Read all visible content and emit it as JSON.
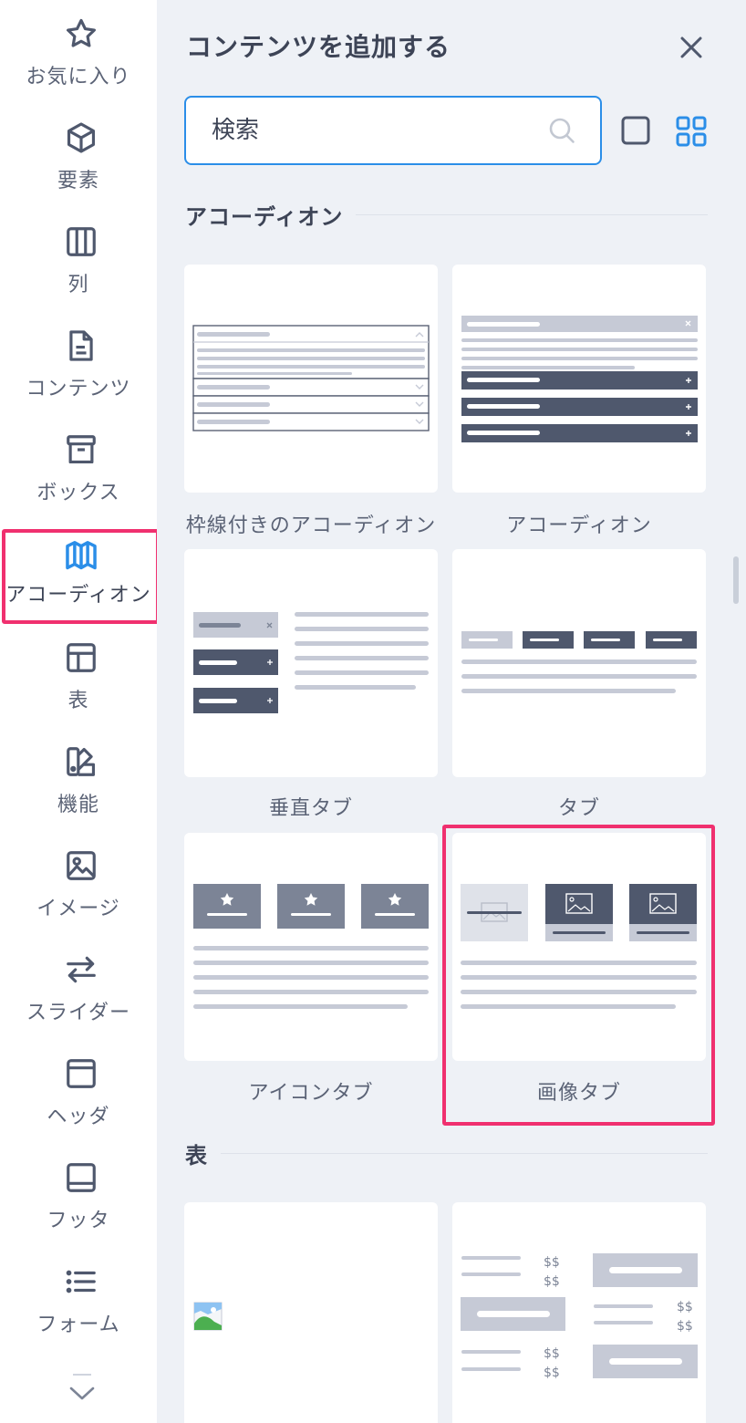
{
  "sidebar": {
    "items": [
      {
        "id": "favorites",
        "label": "お気に入り",
        "icon": "star-icon"
      },
      {
        "id": "elements",
        "label": "要素",
        "icon": "cube-icon"
      },
      {
        "id": "columns",
        "label": "列",
        "icon": "columns-icon"
      },
      {
        "id": "content",
        "label": "コンテンツ",
        "icon": "document-icon"
      },
      {
        "id": "box",
        "label": "ボックス",
        "icon": "archive-box-icon"
      },
      {
        "id": "accordion",
        "label": "アコーディオン",
        "icon": "map-icon",
        "active": true
      },
      {
        "id": "table",
        "label": "表",
        "icon": "table-icon"
      },
      {
        "id": "features",
        "label": "機能",
        "icon": "swatch-icon"
      },
      {
        "id": "image",
        "label": "イメージ",
        "icon": "image-icon"
      },
      {
        "id": "slider",
        "label": "スライダー",
        "icon": "arrows-swap-icon"
      },
      {
        "id": "header",
        "label": "ヘッダ",
        "icon": "header-layout-icon"
      },
      {
        "id": "footer",
        "label": "フッタ",
        "icon": "footer-layout-icon"
      },
      {
        "id": "form",
        "label": "フォーム",
        "icon": "list-icon"
      }
    ],
    "more_icon": "chevron-down-icon"
  },
  "panel": {
    "title": "コンテンツを追加する",
    "close_icon": "close-icon",
    "search": {
      "value": "",
      "placeholder": "検索",
      "icon": "search-icon"
    },
    "view_toggle": {
      "single_icon": "square-view-icon",
      "grid_icon": "grid-view-icon",
      "active": "grid"
    }
  },
  "sections": [
    {
      "title": "アコーディオン",
      "cards": [
        {
          "label": "枠線付きのアコーディオン"
        },
        {
          "label": "アコーディオン"
        },
        {
          "label": "垂直タブ"
        },
        {
          "label": "タブ"
        },
        {
          "label": "アイコンタブ"
        },
        {
          "label": "画像タブ",
          "highlighted": true
        }
      ]
    },
    {
      "title": "表",
      "cards": [
        {
          "label": ""
        },
        {
          "label": "",
          "price_texts": [
            "$$",
            "$$",
            "$$",
            "$$",
            "$$",
            "$$"
          ]
        }
      ]
    }
  ],
  "colors": {
    "accent": "#2b8ee8",
    "highlight": "#f0306f",
    "panel_bg": "#eef1f6",
    "dark_bar": "#4f586d",
    "light_bar": "#c6cad6",
    "text": "#3d4456"
  }
}
